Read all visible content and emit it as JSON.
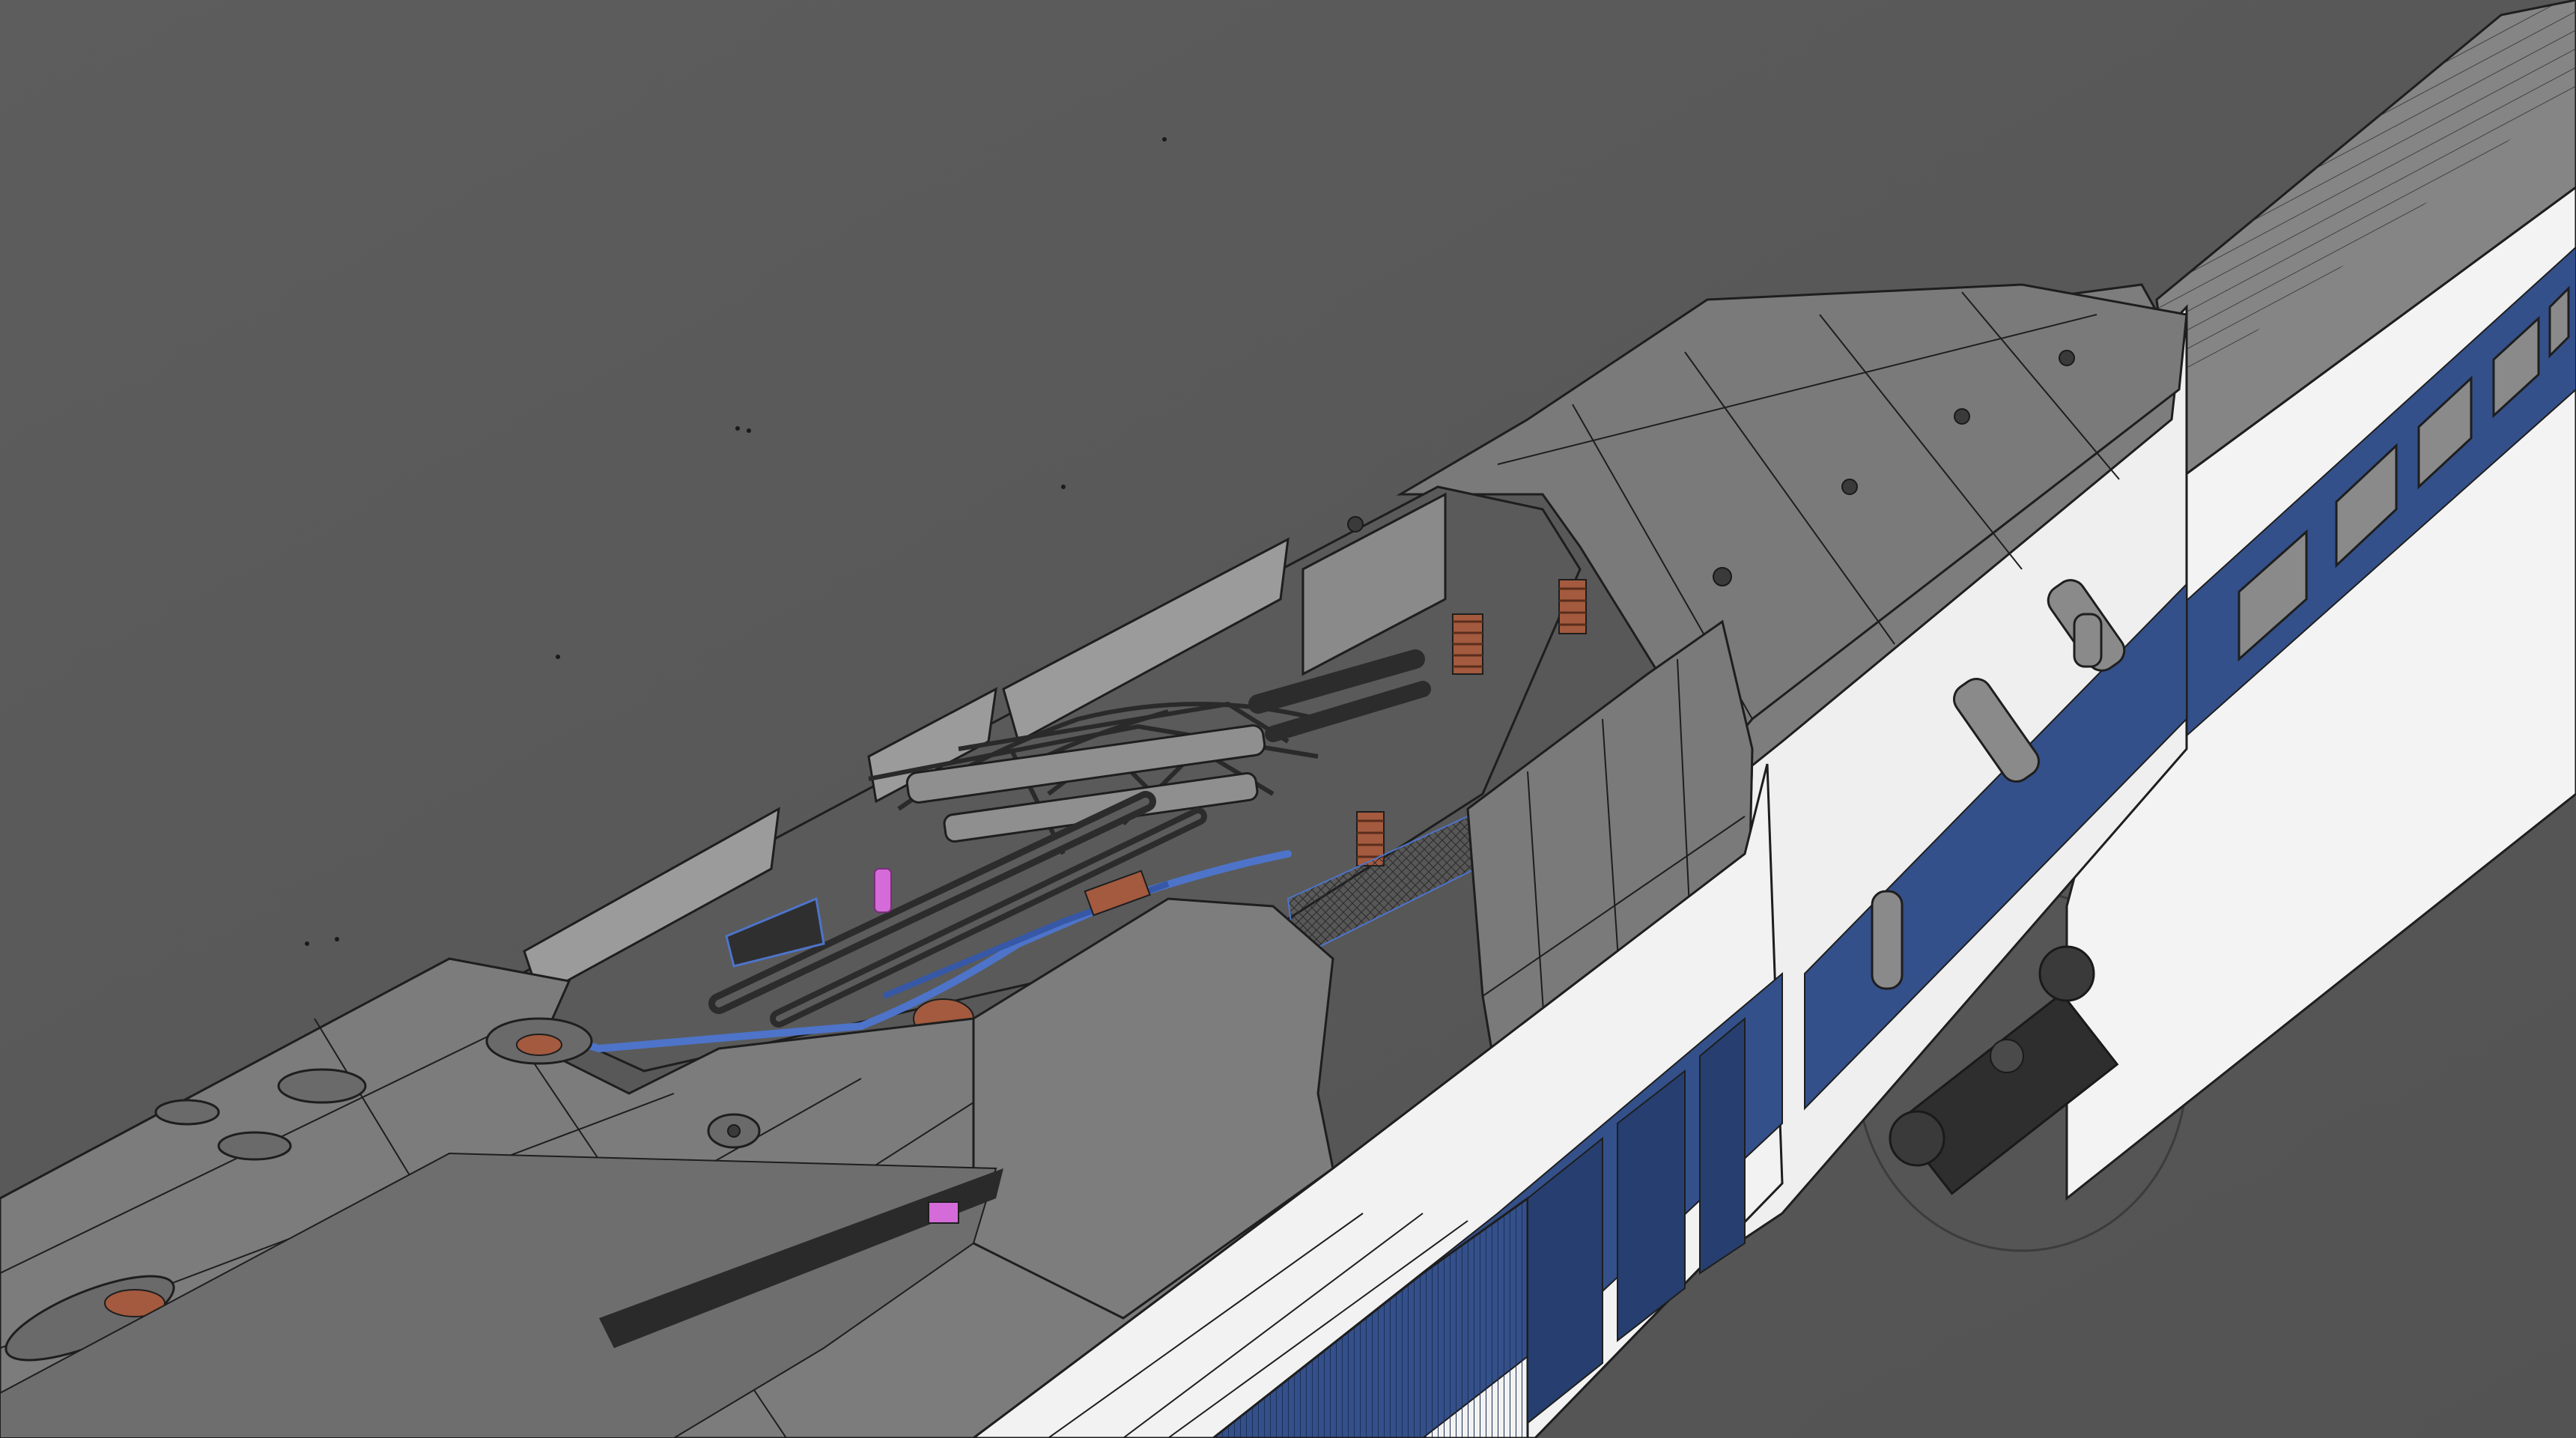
{
  "scene": {
    "background_color": "#595959",
    "body_color": "#7b7b7b",
    "body_light_color": "#8e8e8e",
    "white_color": "#f4f4f4",
    "stripe_color": "#34508a",
    "stripe_dark_color": "#263f70",
    "edge_color": "#1e1e1e",
    "highlight_blue": "#4d74c9",
    "highlight_pink": "#d56bd8",
    "spring_color": "#a35a3e"
  }
}
